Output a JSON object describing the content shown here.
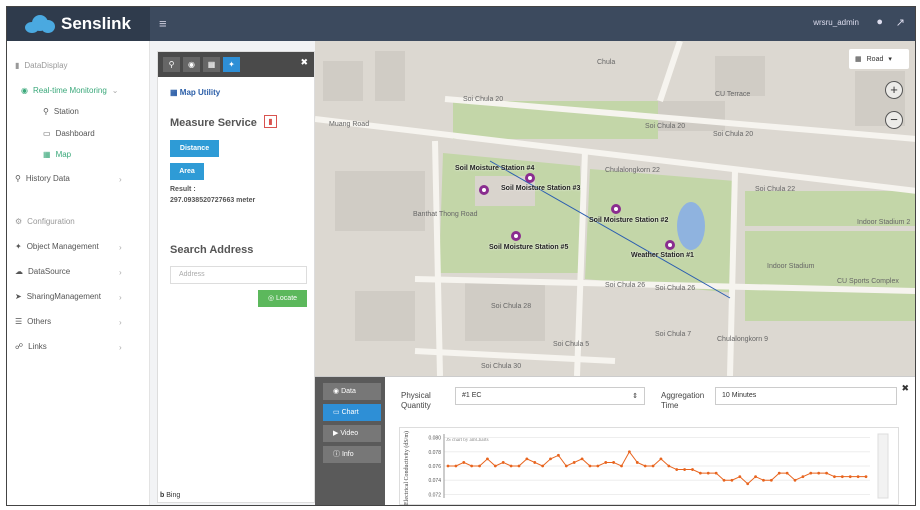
{
  "app": {
    "brand": "Senslink",
    "user": "wrsru_admin"
  },
  "sidebar": {
    "items": [
      {
        "label": "DataDisplay",
        "level": 0
      },
      {
        "label": "Real-time Monitoring",
        "level": 1
      },
      {
        "label": "Station",
        "level": 2
      },
      {
        "label": "Dashboard",
        "level": 2
      },
      {
        "label": "Map",
        "level": 2
      },
      {
        "label": "History Data",
        "level": 0
      },
      {
        "label": "Configuration",
        "level": 0
      },
      {
        "label": "Object Management",
        "level": 0
      },
      {
        "label": "DataSource",
        "level": 0
      },
      {
        "label": "SharingManagement",
        "level": 0
      },
      {
        "label": "Others",
        "level": 0
      },
      {
        "label": "Links",
        "level": 0
      }
    ]
  },
  "utility": {
    "title": "Map Utility",
    "measure_title": "Measure Service",
    "distance_btn": "Distance",
    "area_btn": "Area",
    "result_label": "Result :",
    "result_value": "297.0938520727663 meter",
    "search_title": "Search Address",
    "address_placeholder": "Address",
    "locate_btn": "Locate",
    "bing": "Bing"
  },
  "map": {
    "road_control": "Road",
    "labels": [
      "Soi Chula 20",
      "Soi Chula 20",
      "Soi Chula 20",
      "CU Terrace",
      "Chulalongkorn 22",
      "Soi Chula 22",
      "Indoor Stadium 2",
      "Indoor Stadium",
      "CU Sports Complex",
      "Soi Chula 26",
      "Soi Chula 26",
      "Soi Chula 28",
      "Soi Chula 30",
      "Soi Chula 5",
      "Soi Chula 7",
      "Chulalongkorn 9",
      "Banthat Thong Road",
      "Muang Road",
      "Chula"
    ],
    "stations": [
      {
        "name": "Soil Moisture Station #4"
      },
      {
        "name": "Soil Moisture Station #3"
      },
      {
        "name": "Soil Moisture Station #2"
      },
      {
        "name": "Soil Moisture Station #5"
      },
      {
        "name": "Weather Station #1"
      }
    ]
  },
  "bottom": {
    "tabs": [
      "Data",
      "Chart",
      "Video",
      "Info"
    ],
    "physical_quantity_label": "Physical Quantity",
    "physical_quantity_value": "#1 EC",
    "aggregation_label": "Aggregation Time",
    "aggregation_value": "10 Minutes"
  },
  "chart_data": {
    "type": "line",
    "credit": "JS chart by amCharts",
    "ylabel": "Electrical Conductivity (dS/m)",
    "yticks": [
      "0.080",
      "0.078",
      "0.076",
      "0.074",
      "0.072"
    ],
    "ylim": [
      0.0715,
      0.0805
    ],
    "color": "#e8641e",
    "values": [
      0.076,
      0.076,
      0.0765,
      0.076,
      0.076,
      0.077,
      0.076,
      0.0765,
      0.076,
      0.076,
      0.077,
      0.0765,
      0.076,
      0.077,
      0.0775,
      0.076,
      0.0765,
      0.077,
      0.076,
      0.076,
      0.0765,
      0.0765,
      0.076,
      0.078,
      0.0765,
      0.076,
      0.076,
      0.077,
      0.076,
      0.0755,
      0.0755,
      0.0755,
      0.075,
      0.075,
      0.075,
      0.074,
      0.074,
      0.0745,
      0.0735,
      0.0745,
      0.074,
      0.074,
      0.075,
      0.075,
      0.074,
      0.0745,
      0.075,
      0.075,
      0.075,
      0.0745,
      0.0745,
      0.0745,
      0.0745,
      0.0745
    ]
  }
}
